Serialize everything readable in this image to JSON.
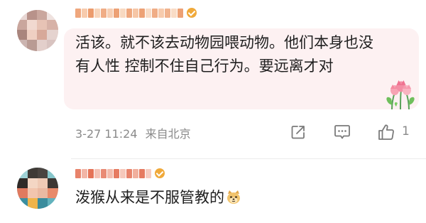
{
  "comments": [
    {
      "avatar": "blurred-profile-avatar",
      "username_color": "#e98a52",
      "badge_color": "#f0a93a",
      "text": "活该。就不该去动物园喂动物。他们本身也没有人性 控制不住自己行为。要远离才对",
      "sticker": "tulip-bouquet",
      "date": "3-27 11:24",
      "location": "来自北京",
      "like_count": "1"
    },
    {
      "avatar": "blurred-cartoon-avatar",
      "username_color": "#e05a3a",
      "badge_color": "#f0a93a",
      "text": "泼猴从来是不服管教的",
      "emoji": "doge-emoji"
    }
  ],
  "actions": {
    "share_icon": "share-icon",
    "comment_icon": "comment-icon",
    "like_icon": "thumbs-up-icon"
  },
  "colors": {
    "bubble": "#fdf1f2",
    "meta_text": "#8a8a8a"
  }
}
